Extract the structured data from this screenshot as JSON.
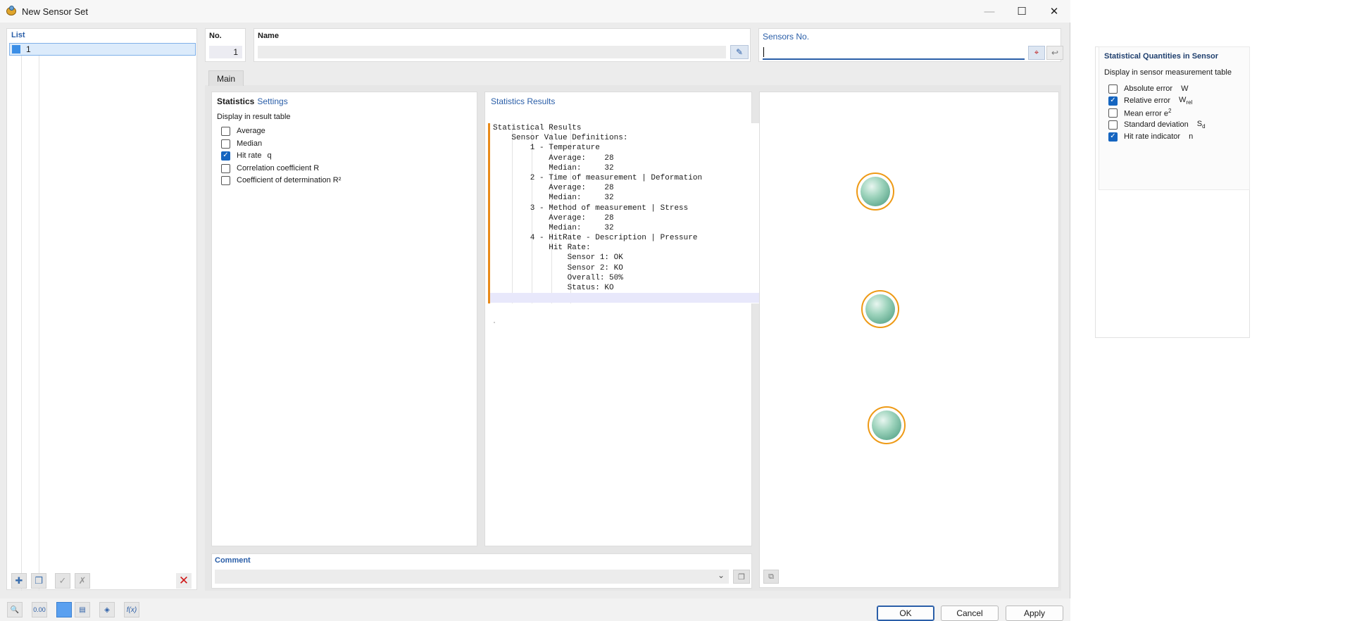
{
  "window": {
    "title": "New Sensor Set",
    "controls": {
      "minimize": "—",
      "maximize": "☐",
      "close": "✕"
    }
  },
  "list": {
    "label": "List",
    "items": [
      "1"
    ]
  },
  "fields": {
    "no_label": "No.",
    "no_value": "1",
    "name_label": "Name",
    "name_value": "",
    "sensors_label": "Sensors No.",
    "sensors_value": ""
  },
  "tabs": [
    "Main"
  ],
  "statistics": {
    "heading": "Statistics",
    "heading_link": "Settings",
    "subtitle": "Display in result table",
    "options": [
      {
        "label": "Average",
        "symbol": "",
        "checked": false
      },
      {
        "label": "Median",
        "symbol": "",
        "checked": false
      },
      {
        "label": "Hit rate",
        "symbol": "q",
        "checked": true
      },
      {
        "label": "Correlation coefficient R",
        "symbol": "",
        "checked": false
      },
      {
        "label": "Coefficient of determination R²",
        "symbol": "",
        "checked": false
      }
    ]
  },
  "results": {
    "heading": "Statistics Results",
    "lines": [
      "Statistical Results",
      "    Sensor Value Definitions:",
      "        1 - Temperature",
      "            Average:    28",
      "            Median:     32",
      "        2 - Time of measurement | Deformation",
      "            Average:    28",
      "            Median:     32",
      "        3 - Method of measurement | Stress",
      "            Average:    28",
      "            Median:     32",
      "        4 - HitRate - Description | Pressure",
      "            Hit Rate:",
      "                Sensor 1: OK",
      "                Sensor 2: KO",
      "                Overall: 50%",
      "                Status: KO",
      ""
    ]
  },
  "comment": {
    "label": "Comment",
    "value": ""
  },
  "buttons": {
    "ok": "OK",
    "cancel": "Cancel",
    "apply": "Apply"
  },
  "bottom_toolbar": {
    "units_icon_text": "0.00",
    "function_icon_text": "f(x)"
  },
  "side_panel": {
    "title": "Statistical Quantities in Sensor",
    "subtitle": "Display in sensor measurement table",
    "options": [
      {
        "label": "Absolute error",
        "symbol": "W",
        "sub": "",
        "sup": "",
        "checked": false
      },
      {
        "label": "Relative error",
        "symbol": "W",
        "sub": "rel",
        "sup": "",
        "checked": true
      },
      {
        "label": "Mean error e",
        "symbol": "",
        "sub": "",
        "sup": "2",
        "checked": false
      },
      {
        "label": "Standard deviation",
        "symbol": "S",
        "sub": "d",
        "sup": "",
        "checked": false
      },
      {
        "label": "Hit rate indicator",
        "symbol": "n",
        "sub": "",
        "sup": "",
        "checked": true
      }
    ]
  },
  "colors": {
    "accent": "#2a5ea8",
    "check": "#1565c0",
    "sensor_ring": "#ee9a16",
    "error": "#d01818"
  }
}
